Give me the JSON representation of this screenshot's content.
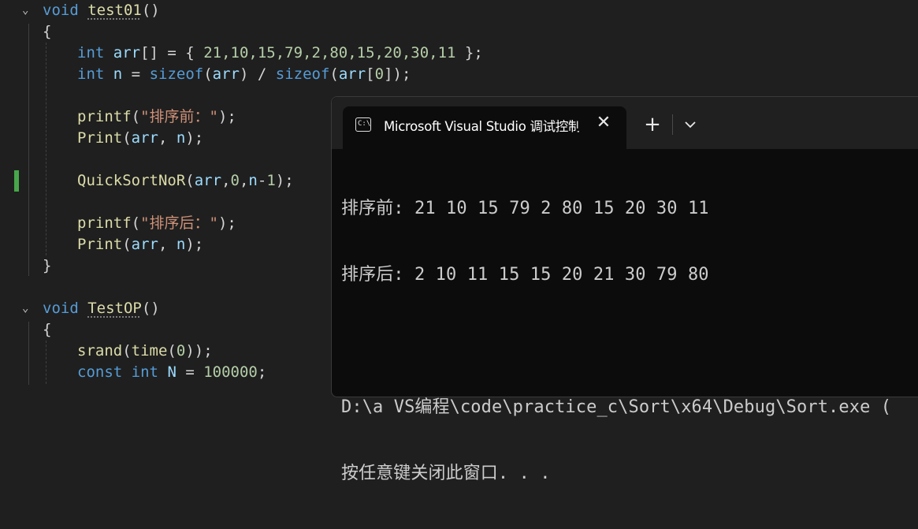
{
  "editor": {
    "lines": {
      "l1": {
        "kw": "void",
        "name": "test01",
        "rest": "()"
      },
      "l2": {
        "text": "{"
      },
      "l3": {
        "kw": "int",
        "id": "arr",
        "op": "[] = { ",
        "nums": "21,10,15,79,2,80,15,20,30,11",
        "end": " };"
      },
      "l4": {
        "kw": "int",
        "id": "n",
        "op1": " = ",
        "fn1": "sizeof",
        "p1": "(",
        "id2": "arr",
        "p2": ") / ",
        "fn2": "sizeof",
        "p3": "(",
        "id3": "arr",
        "p4": "[",
        "num": "0",
        "p5": "]);"
      },
      "l6": {
        "fn": "printf",
        "p1": "(",
        "str": "\"排序前：\"",
        "p2": ");"
      },
      "l7": {
        "fn": "Print",
        "p1": "(",
        "id1": "arr",
        "p2": ", ",
        "id2": "n",
        "p3": ");"
      },
      "l9": {
        "fn": "QuickSortNoR",
        "p1": "(",
        "id1": "arr",
        "p2": ",",
        "num1": "0",
        "p3": ",",
        "id2": "n",
        "p4": "-",
        "num2": "1",
        "p5": ");"
      },
      "l11": {
        "fn": "printf",
        "p1": "(",
        "str": "\"排序后：\"",
        "p2": ");"
      },
      "l12": {
        "fn": "Print",
        "p1": "(",
        "id1": "arr",
        "p2": ", ",
        "id2": "n",
        "p3": ");"
      },
      "l13": {
        "text": "}"
      },
      "l15": {
        "kw": "void",
        "name": "TestOP",
        "rest": "()"
      },
      "l16": {
        "text": "{"
      },
      "l17": {
        "fn1": "srand",
        "p1": "(",
        "fn2": "time",
        "p2": "(",
        "num": "0",
        "p3": "));"
      },
      "l18": {
        "kw1": "const",
        "kw2": "int",
        "id": "N",
        "op": " = ",
        "num": "100000",
        "end": ";"
      }
    },
    "fold_glyph": "⌄"
  },
  "console": {
    "tab_icon": "C:\\",
    "tab_title": "Microsoft Visual Studio 调试控制台",
    "close_glyph": "✕",
    "new_tab_glyph": "+",
    "output": {
      "line1": "排序前: 21 10 15 79 2 80 15 20 30 11",
      "line2": "排序后: 2 10 11 15 15 20 21 30 79 80",
      "line3": "",
      "line4": "D:\\a VS编程\\code\\practice_c\\Sort\\x64\\Debug\\Sort.exe (",
      "line5": "按任意键关闭此窗口. . ."
    }
  },
  "colors": {
    "editor_bg": "#1f1f1f",
    "keyword": "#569cd6",
    "function": "#dcdcaa",
    "identifier": "#9cdcfe",
    "number": "#b5cea8",
    "string": "#ce9178",
    "console_bg": "#0c0c0c",
    "titlebar_bg": "#202020",
    "change_bar": "#48a64a"
  }
}
